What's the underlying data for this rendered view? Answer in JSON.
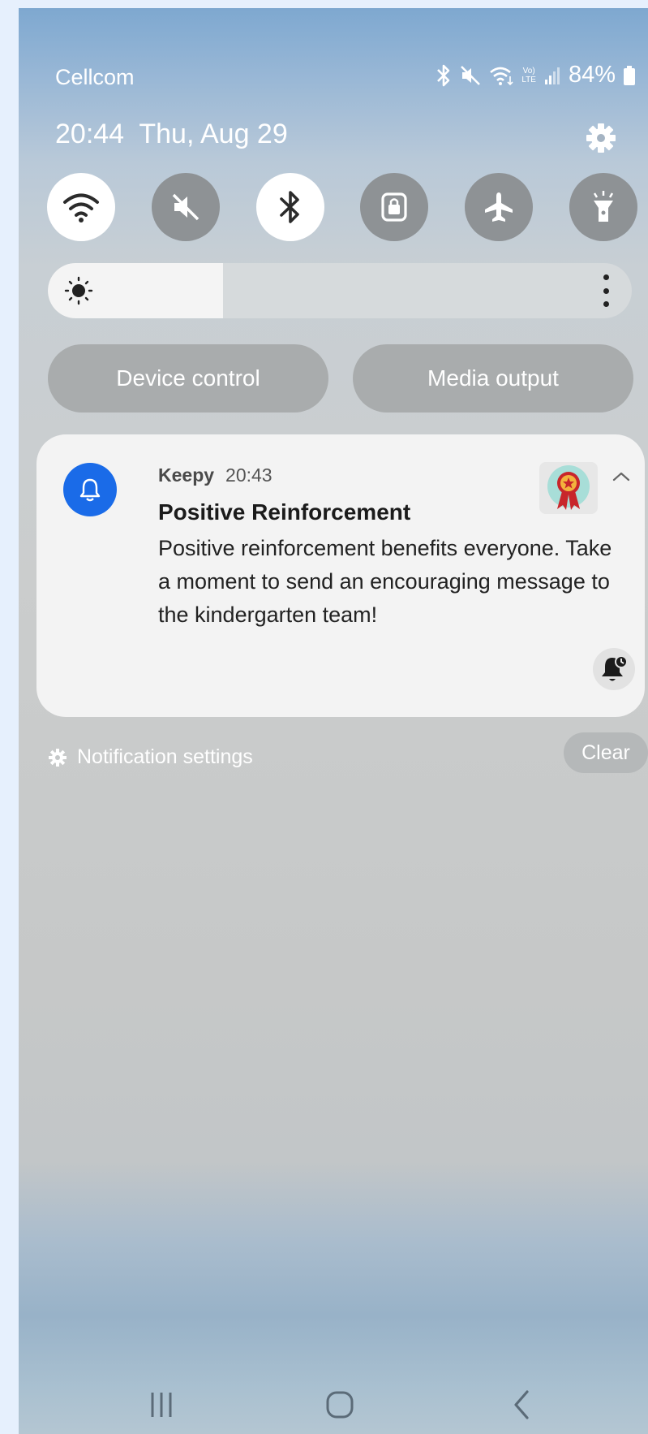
{
  "status_bar": {
    "carrier": "Cellcom",
    "volte_label_top": "Vo)",
    "volte_label_bottom": "LTE",
    "battery_text": "84%",
    "icons": [
      "bluetooth-icon",
      "mute-icon",
      "wifi-icon",
      "volte-icon",
      "signal-icon",
      "battery-icon"
    ]
  },
  "header": {
    "time": "20:44",
    "date": "Thu, Aug 29",
    "settings_icon": "gear-icon"
  },
  "quick_settings": [
    {
      "name": "wifi",
      "icon": "wifi-icon",
      "state": "on"
    },
    {
      "name": "sound",
      "icon": "mute-icon",
      "state": "off"
    },
    {
      "name": "bluetooth",
      "icon": "bluetooth-icon",
      "state": "on"
    },
    {
      "name": "rotation-lock",
      "icon": "lock-icon",
      "state": "off"
    },
    {
      "name": "airplane-mode",
      "icon": "airplane-icon",
      "state": "off"
    },
    {
      "name": "flashlight",
      "icon": "flashlight-icon",
      "state": "off"
    }
  ],
  "brightness": {
    "level": 0.3,
    "icon": "sun-icon",
    "more_icon": "more-vertical-icon"
  },
  "buttons": {
    "device_control": "Device control",
    "media_output": "Media output"
  },
  "notification": {
    "app_name": "Keepy",
    "time": "20:43",
    "title": "Positive Reinforcement",
    "body": "Positive reinforcement benefits everyone. Take a moment to send an encouraging message to the kindergarten team!",
    "app_icon": "bell-icon",
    "thumbnail": "award-ribbon-icon",
    "action_icon": "snooze-bell-icon",
    "colors": {
      "app_icon_bg": "#1a6be8",
      "card_bg": "#f3f3f3"
    }
  },
  "footer": {
    "notification_settings": "Notification settings",
    "clear": "Clear"
  },
  "nav_bar": {
    "recents_icon": "recents-icon",
    "home_icon": "home-icon",
    "back_icon": "back-icon"
  }
}
